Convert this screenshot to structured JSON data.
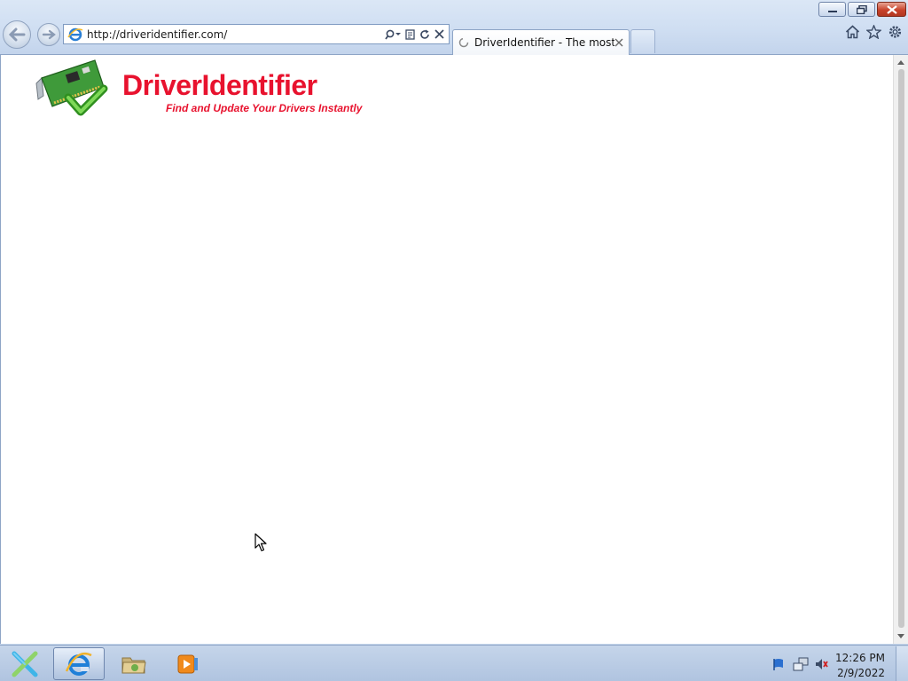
{
  "browser": {
    "address_url": "http://driveridentifier.com/",
    "tab_title": "DriverIdentifier - The most ..."
  },
  "page": {
    "logo_text": "DriverIdentifier",
    "tagline": "Find and Update Your Drivers Instantly"
  },
  "taskbar": {
    "items": [
      "start-icon",
      "internet-explorer-icon",
      "file-explorer-icon",
      "media-player-icon"
    ],
    "tray": {
      "time": "12:26 PM",
      "date": "2/9/2022"
    }
  },
  "colors": {
    "brand_red": "#e8122e",
    "chrome_blue": "#cfdef2"
  }
}
